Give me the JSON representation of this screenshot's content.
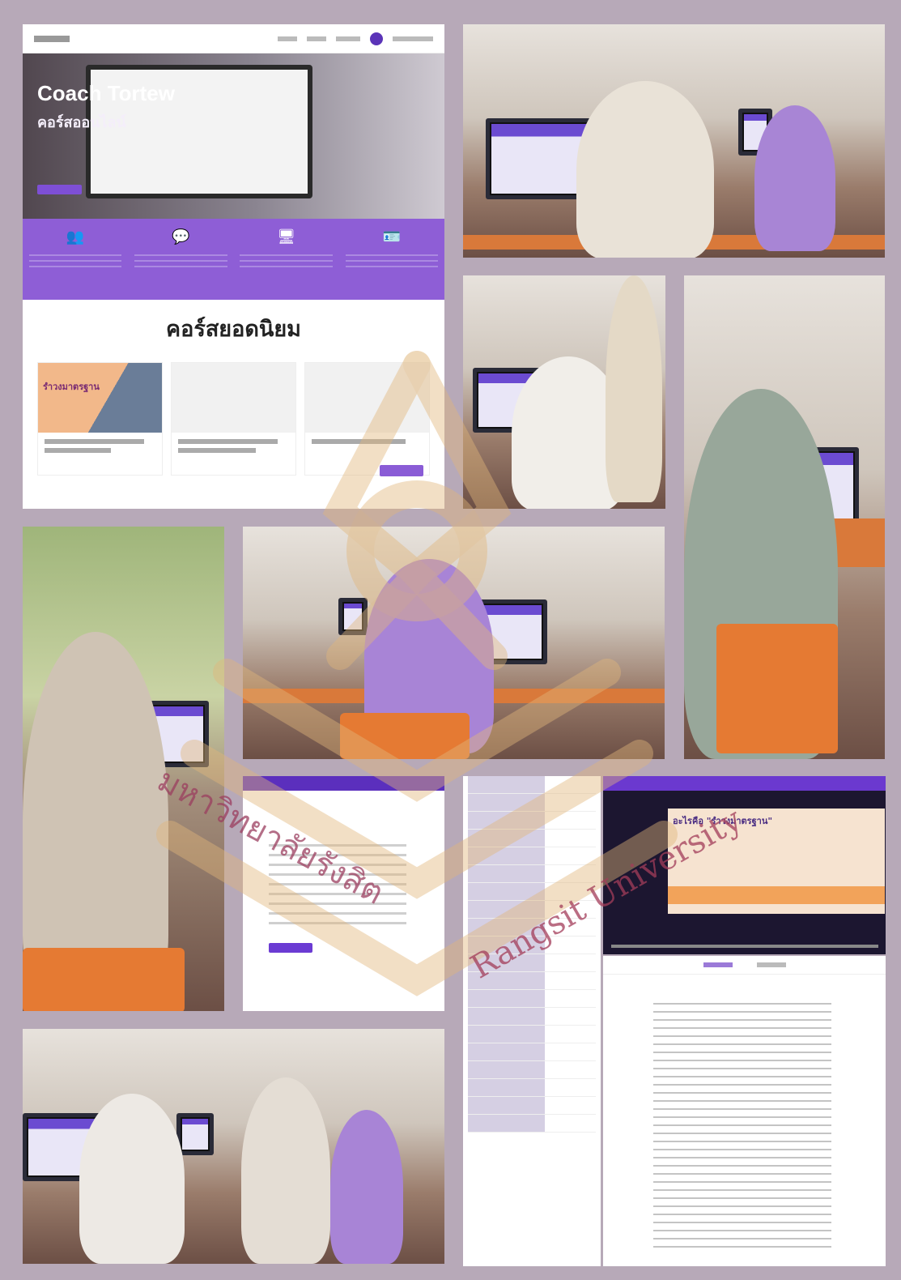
{
  "website": {
    "hero_title": "Coach Tortew",
    "hero_subtitle": "คอร์สออนไลน์",
    "popular_heading": "คอร์สยอดนิยม",
    "featured_card_label": "รำวงมาตรฐาน"
  },
  "video": {
    "slide_heading": "อะไรคือ \"รำวงมาตรฐาน\""
  },
  "watermark": {
    "thai": "มหาวิทยาลัยรังสิต",
    "english": "Rangsit University"
  },
  "icons": [
    "group-icon",
    "chat-icon",
    "teacher-icon",
    "certificate-icon"
  ]
}
